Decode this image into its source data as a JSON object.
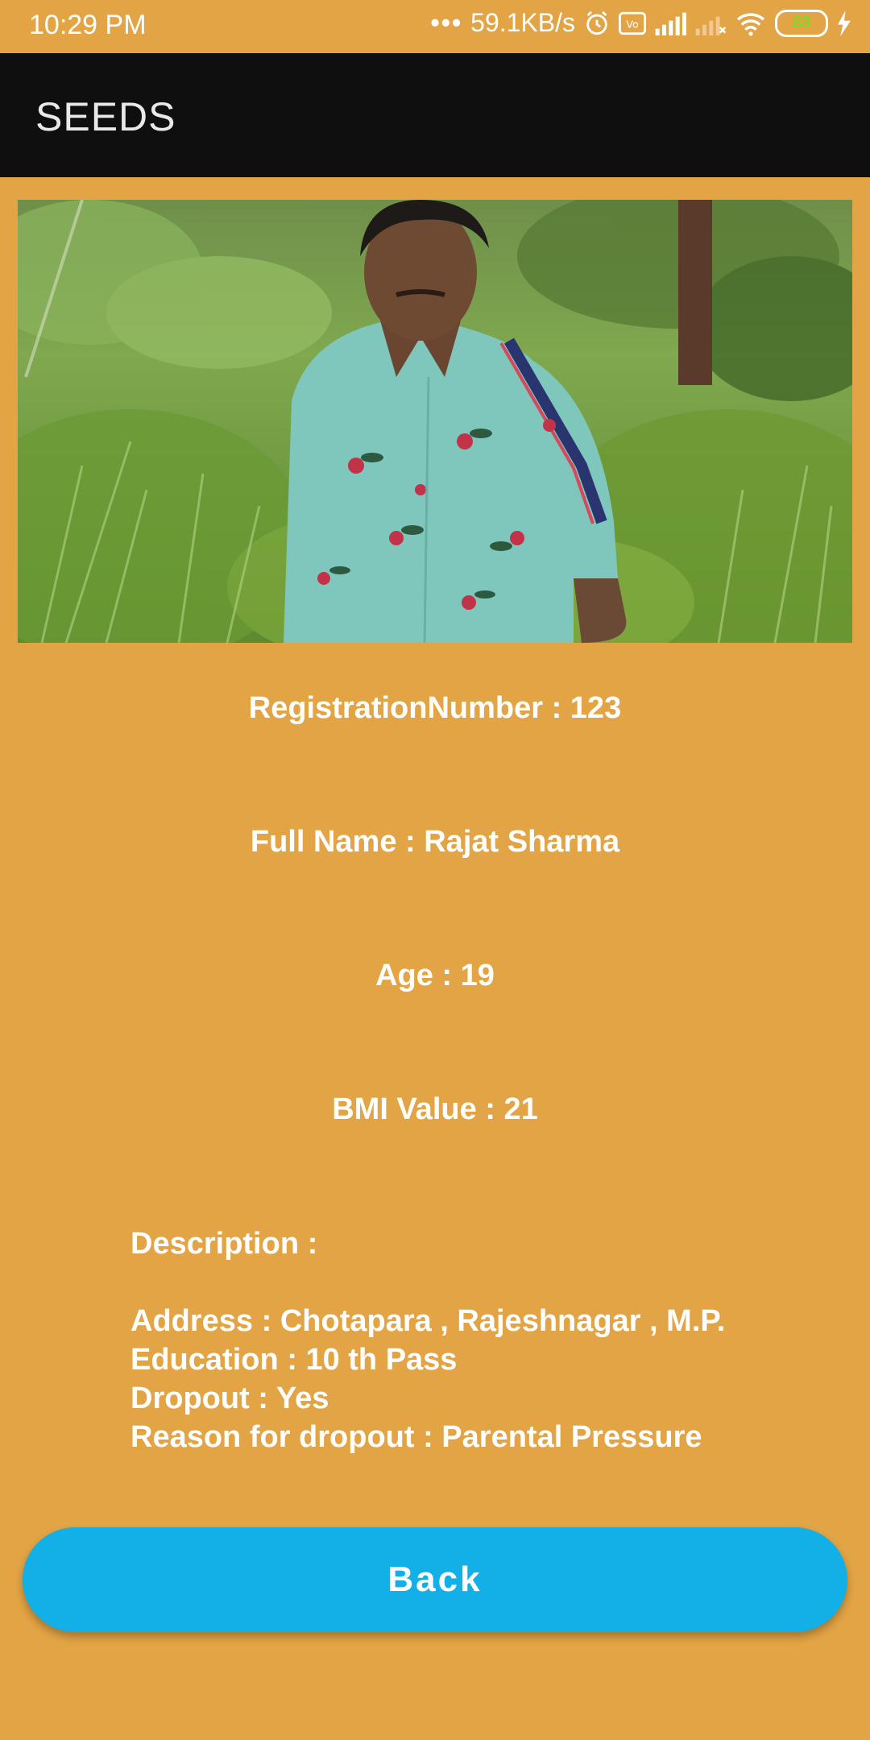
{
  "status_bar": {
    "time": "10:29 PM",
    "network_speed": "59.1KB/s",
    "battery": "83",
    "icons": [
      "alarm-icon",
      "volte-icon",
      "signal-icon",
      "signal-no-service-icon",
      "wifi-icon",
      "battery-icon",
      "charging-icon"
    ]
  },
  "app_bar": {
    "title": "SEEDS"
  },
  "profile": {
    "registration": "RegistrationNumber : 123",
    "full_name": "Full Name : Rajat Sharma",
    "age": "Age : 19",
    "bmi": "BMI Value : 21",
    "description_label": "Description :",
    "address": "Address : Chotapara , Rajeshnagar , M.P.",
    "education": "Education : 10 th Pass",
    "dropout": "Dropout : Yes",
    "reason": "Reason for dropout : Parental Pressure"
  },
  "actions": {
    "back_label": "Back"
  },
  "colors": {
    "background": "#E2A444",
    "app_bar": "#0F0F0F",
    "button": "#12B0E6",
    "text": "#FFFFFF"
  }
}
